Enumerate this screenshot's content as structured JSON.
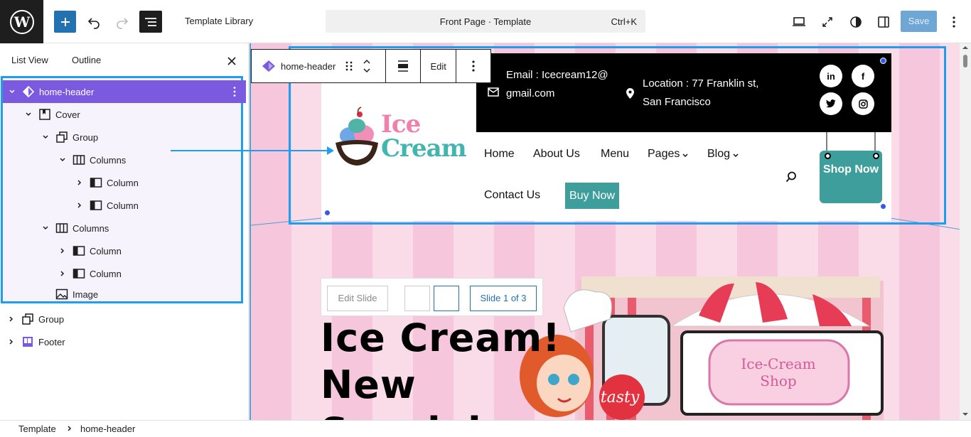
{
  "topbar": {
    "title": "Template Library",
    "command_title": "Front Page · Template",
    "command_shortcut": "Ctrl+K",
    "save_label": "Save"
  },
  "list_view": {
    "tabs": [
      "List View",
      "Outline"
    ],
    "items": [
      {
        "label": "home-header",
        "depth": 0,
        "icon": "template-part-icon"
      },
      {
        "label": "Cover",
        "depth": 1,
        "icon": "cover-icon"
      },
      {
        "label": "Group",
        "depth": 2,
        "icon": "group-icon"
      },
      {
        "label": "Columns",
        "depth": 3,
        "icon": "columns-icon"
      },
      {
        "label": "Column",
        "depth": 4,
        "icon": "column-icon"
      },
      {
        "label": "Column",
        "depth": 4,
        "icon": "column-icon"
      },
      {
        "label": "Columns",
        "depth": 2,
        "icon": "columns-icon"
      },
      {
        "label": "Column",
        "depth": 3,
        "icon": "column-icon"
      },
      {
        "label": "Column",
        "depth": 3,
        "icon": "column-icon"
      },
      {
        "label": "Image",
        "depth": 2,
        "icon": "image-icon"
      },
      {
        "label": "Group",
        "depth": 0,
        "icon": "group-icon"
      },
      {
        "label": "Footer",
        "depth": 0,
        "icon": "footer-icon"
      }
    ]
  },
  "breadcrumb": {
    "items": [
      "Template",
      "home-header"
    ]
  },
  "block_toolbar": {
    "block_name": "home-header",
    "edit_label": "Edit"
  },
  "site": {
    "logo_line1": "Ice",
    "logo_line2": "Cream",
    "email": "Email : Icecream12@gmail.com",
    "location": "Location : 77 Franklin st, San Francisco",
    "socials": [
      "in",
      "f"
    ],
    "nav": {
      "home": "Home",
      "about": "About Us",
      "menu": "Menu",
      "pages": "Pages",
      "blog": "Blog",
      "contact": "Contact Us"
    },
    "buy_now": "Buy Now",
    "shop_now": "Shop Now"
  },
  "slider": {
    "edit_slide": "Edit Slide",
    "counter": "Slide 1 of 3"
  },
  "hero": {
    "line1": "Ice Cream!",
    "line2": "New",
    "line3": "Special",
    "badge": "tasty",
    "sign_line1": "Ice-Cream",
    "sign_line2": "Shop"
  },
  "colors": {
    "wp_blue": "#2271b1",
    "select_purple": "#7b5ae0",
    "outline_blue": "#1e9ef0",
    "teal": "#3e9e9c",
    "pink": "#f07fab"
  }
}
